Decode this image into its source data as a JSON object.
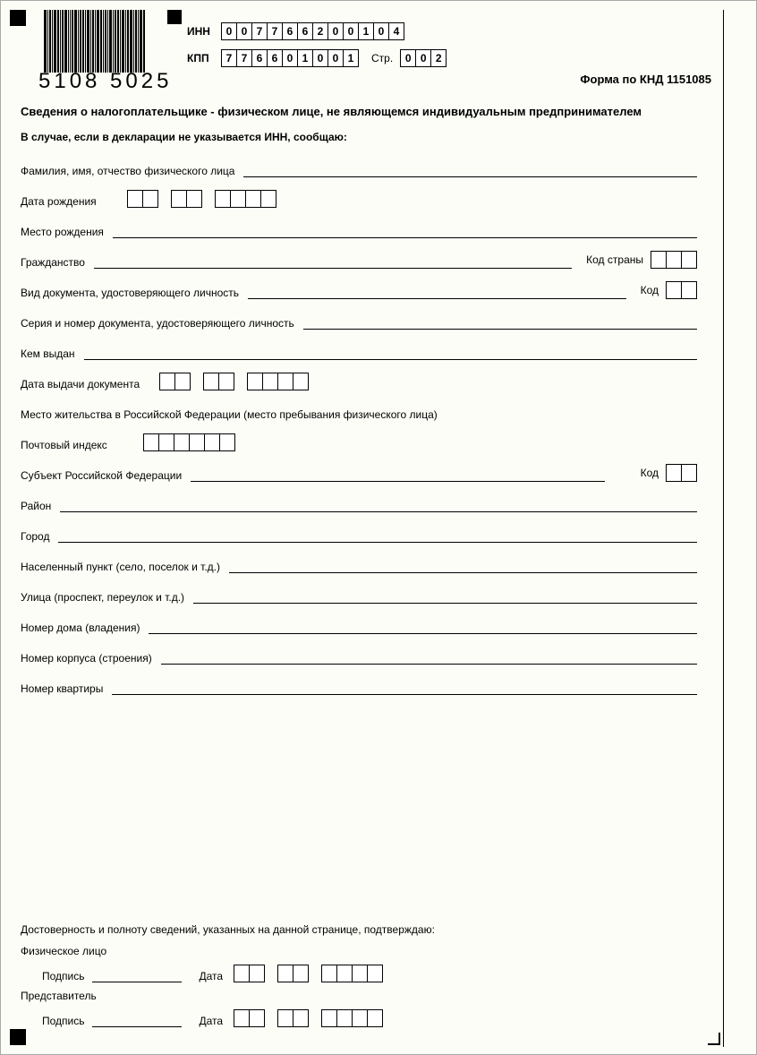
{
  "barcode_number": "5108 5025",
  "header": {
    "inn_label": "ИНН",
    "inn": [
      "0",
      "0",
      "7",
      "7",
      "6",
      "6",
      "2",
      "0",
      "0",
      "1",
      "0",
      "4"
    ],
    "kpp_label": "КПП",
    "kpp": [
      "7",
      "7",
      "6",
      "6",
      "0",
      "1",
      "0",
      "0",
      "1"
    ],
    "page_label": "Стр.",
    "page": [
      "0",
      "0",
      "2"
    ],
    "form_code": "Форма по КНД 1151085"
  },
  "title": "Сведения о налогоплательщике - физическом лице, не являющемся индивидуальным предпринимателем",
  "subtitle": "В случае, если в декларации не указывается ИНН, сообщаю:",
  "fields": {
    "fio": "Фамилия, имя, отчество физического лица",
    "dob": "Дата рождения",
    "birthplace": "Место рождения",
    "citizenship": "Гражданство",
    "country_code": "Код страны",
    "doc_type": "Вид документа, удостоверяющего личность",
    "code": "Код",
    "doc_series": "Серия и номер документа, удостоверяющего личность",
    "issued_by": "Кем выдан",
    "doc_date": "Дата выдачи документа",
    "residence": "Место жительства в Российской Федерации (место пребывания физического лица)",
    "postcode": "Почтовый индекс",
    "subject": "Субъект Российской Федерации",
    "district": "Район",
    "city": "Город",
    "settlement": "Населенный пункт (село, поселок и т.д.)",
    "street": "Улица (проспект, переулок и т.д.)",
    "house": "Номер дома (владения)",
    "building": "Номер корпуса (строения)",
    "flat": "Номер квартиры"
  },
  "confirm": {
    "title": "Достоверность и полноту сведений, указанных на данной странице, подтверждаю:",
    "individual": "Физическое лицо",
    "representative": "Представитель",
    "signature": "Подпись",
    "date": "Дата"
  }
}
